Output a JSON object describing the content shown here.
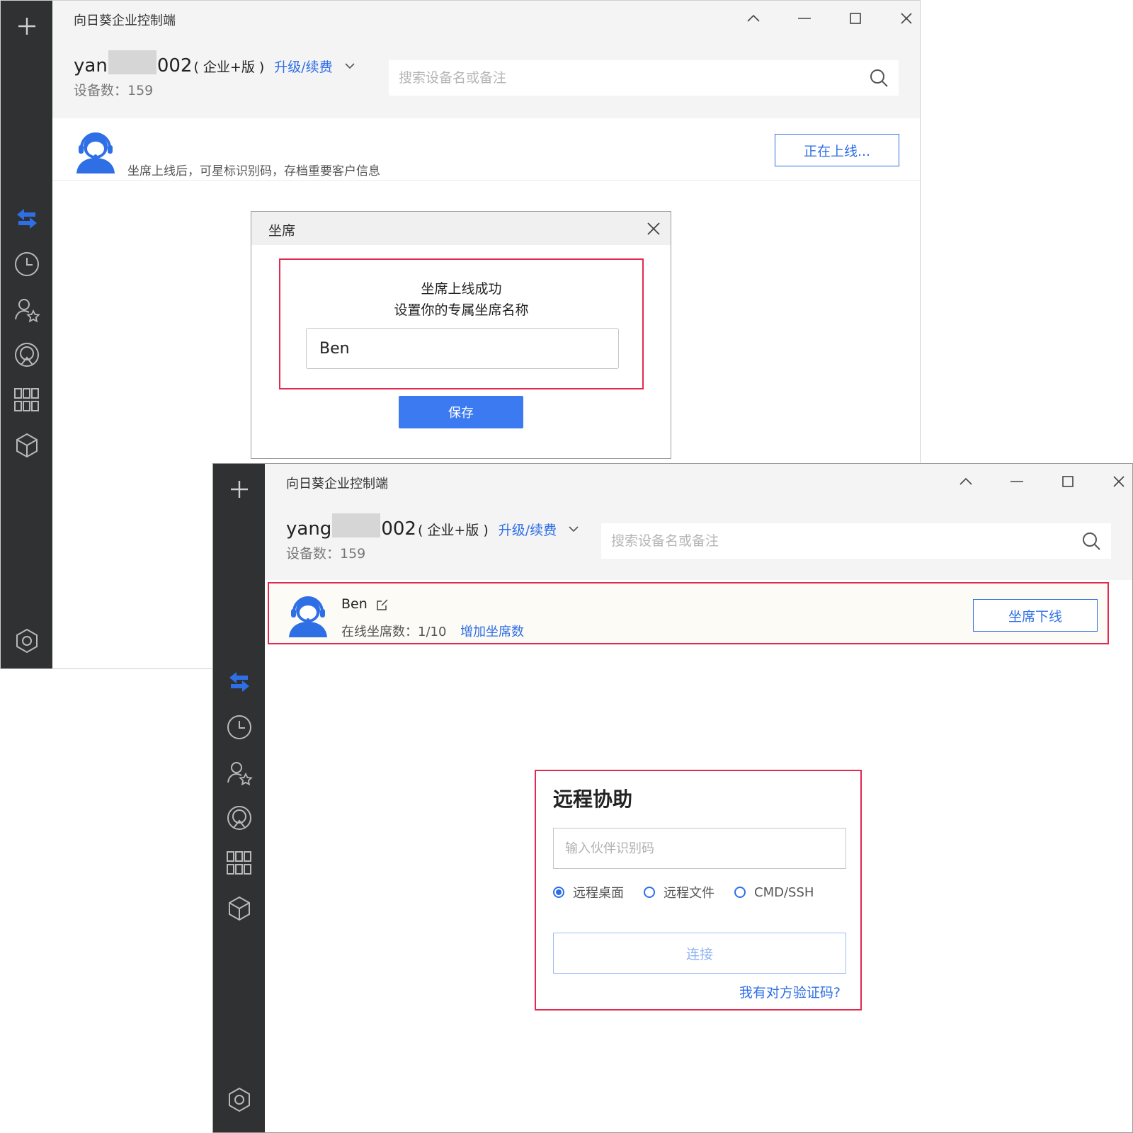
{
  "window1": {
    "title": "向日葵企业控制端",
    "account": {
      "user_prefix": "yan",
      "user_suffix": "002",
      "edition": "( 企业+版 )",
      "upgrade_label": "升级/续费"
    },
    "device_count": "设备数：159",
    "search": {
      "placeholder": "搜索设备名或备注"
    },
    "agent_hint": "坐席上线后，可星标识别码，存档重要客户信息",
    "online_button": "正在上线...",
    "dialog": {
      "title": "坐席",
      "line1": "坐席上线成功",
      "line2": "设置你的专属坐席名称",
      "name_value": "Ben",
      "save_label": "保存"
    }
  },
  "window2": {
    "title": "向日葵企业控制端",
    "account": {
      "user_prefix": "yang",
      "user_suffix": "002",
      "edition": "( 企业+版 )",
      "upgrade_label": "升级/续费"
    },
    "device_count": "设备数：159",
    "search": {
      "placeholder": "搜索设备名或备注"
    },
    "agent": {
      "name": "Ben",
      "seats": "在线坐席数：1/10",
      "add_seats": "增加坐席数",
      "offline_button": "坐席下线"
    },
    "remote_assist": {
      "title": "远程协助",
      "input_placeholder": "输入伙伴识别码",
      "options": [
        "远程桌面",
        "远程文件",
        "CMD/SSH"
      ],
      "selected_option": "远程桌面",
      "connect_label": "连接",
      "verify_link": "我有对方验证码?"
    }
  },
  "colors": {
    "accent": "#2f6fe6",
    "highlight": "#e1284f",
    "sidebar": "#303133",
    "header": "#f4f4f5"
  },
  "icons": [
    "plus-icon",
    "swap-arrows-icon",
    "clock-icon",
    "user-star-icon",
    "remote-camera-icon",
    "apps-grid-icon",
    "cube-icon",
    "settings-hexagon-icon",
    "collapse-icon",
    "minimize-icon",
    "maximize-icon",
    "close-icon",
    "search-icon",
    "headset-avatar-icon",
    "edit-icon"
  ]
}
